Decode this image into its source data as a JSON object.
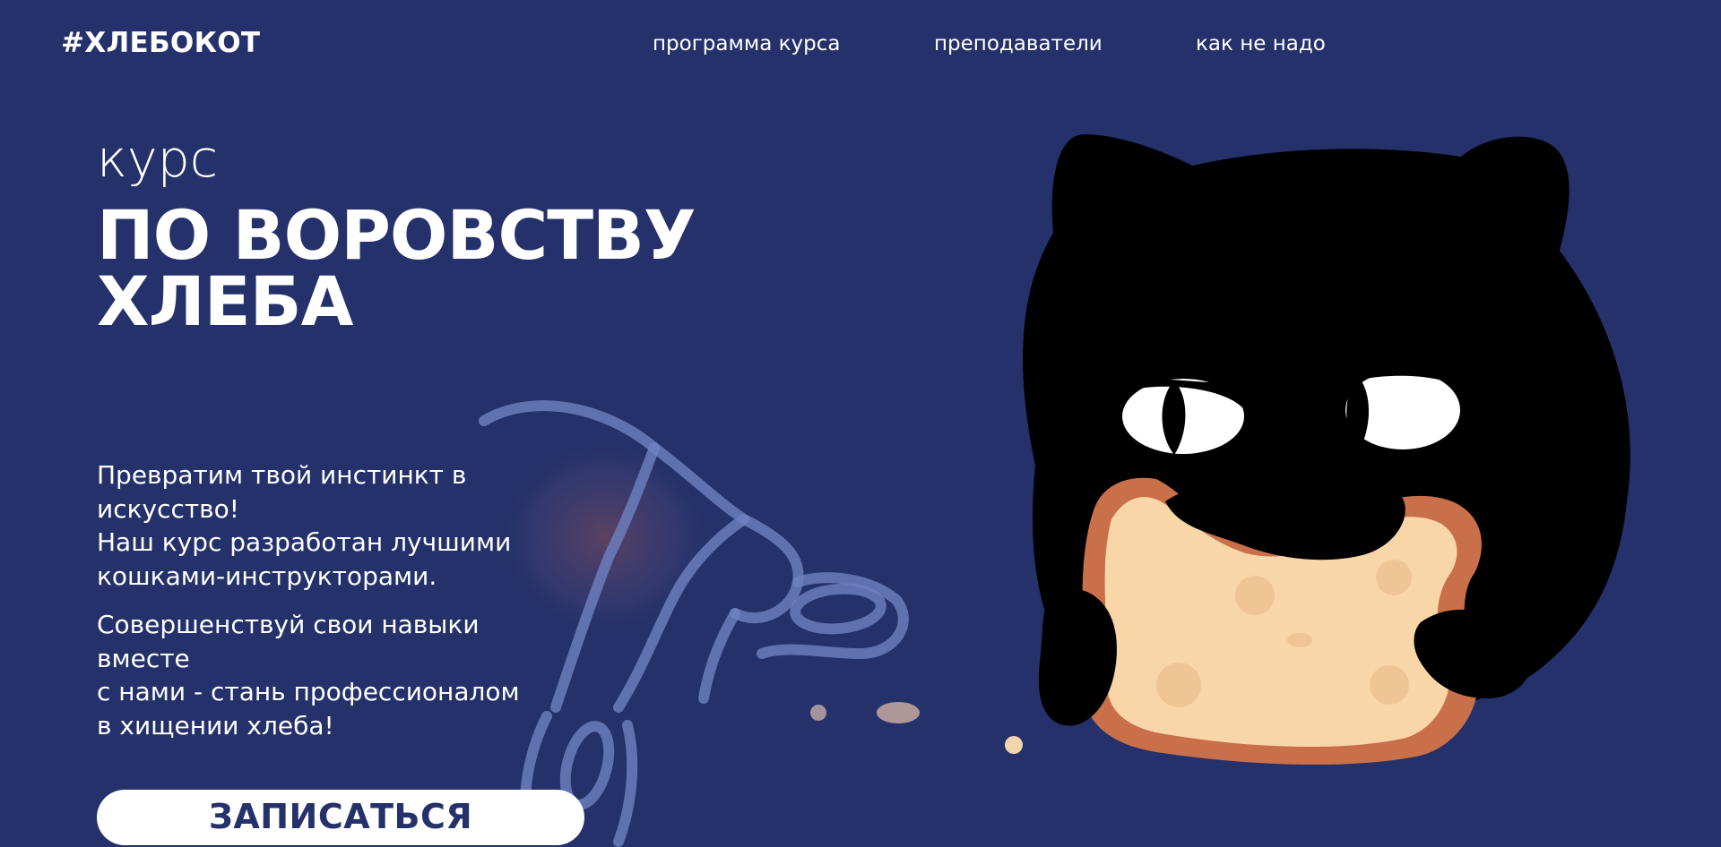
{
  "header": {
    "logo": "#ХЛЕБОКОТ",
    "nav": [
      {
        "label": "программа курса"
      },
      {
        "label": "преподаватели"
      },
      {
        "label": "как не надо"
      }
    ]
  },
  "hero": {
    "kicker": "курс",
    "title_line1": "ПО ВОРОВСТВУ",
    "title_line2": "ХЛЕБА",
    "paragraph1": [
      "Превратим твой инстинкт в",
      "искусство!",
      "Наш курс разработан лучшими",
      "кошками-инструкторами."
    ],
    "paragraph2": [
      "Совершенствуй свои навыки",
      "вместе",
      "с нами - стань профессионалом",
      "в хищении хлеба!"
    ],
    "cta_label": "ЗАПИСАТЬСЯ"
  },
  "colors": {
    "background": "#24316a",
    "text": "#ffffff",
    "button_bg": "#ffffff",
    "button_text": "#24316a",
    "cat": "#000000",
    "bread_crust": "#c9704a",
    "bread_crumb": "#f9d6a8"
  },
  "icons": {
    "cat_illustration": "cat-with-bread-illustration",
    "hand_illustration": "reaching-hand-illustration"
  }
}
